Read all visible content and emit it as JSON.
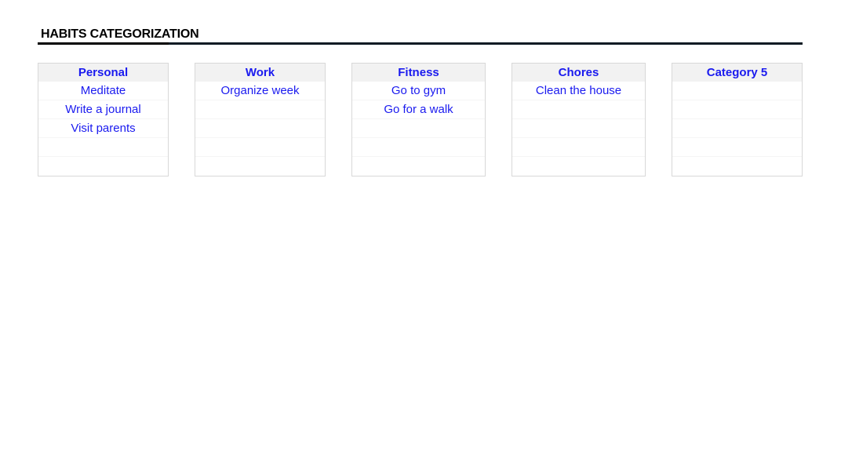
{
  "title": "HABITS CATEGORIZATION",
  "colors": {
    "accent": "#1a1aef",
    "header_bg": "#f2f2f2",
    "border": "#d8d8d8",
    "rule": "#0c1a23"
  },
  "categories": [
    {
      "name": "Personal",
      "items": [
        "Meditate",
        "Write a journal",
        "Visit parents",
        "",
        ""
      ]
    },
    {
      "name": "Work",
      "items": [
        "Organize week",
        "",
        "",
        "",
        ""
      ]
    },
    {
      "name": "Fitness",
      "items": [
        "Go to gym",
        "Go for a walk",
        "",
        "",
        ""
      ]
    },
    {
      "name": "Chores",
      "items": [
        "Clean the house",
        "",
        "",
        "",
        ""
      ]
    },
    {
      "name": "Category 5",
      "items": [
        "",
        "",
        "",
        "",
        ""
      ]
    }
  ]
}
